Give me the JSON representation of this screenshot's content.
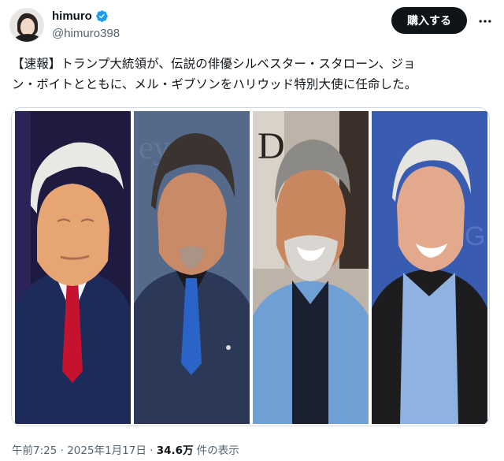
{
  "author": {
    "display_name": "himuro",
    "handle": "@himuro398",
    "verified": true
  },
  "header": {
    "buy_label": "購入する",
    "more_icon": "more-horizontal-icon"
  },
  "tweet": {
    "text_line1": "【速報】トランプ大統領が、伝説の俳優シルベスター・スタローン、ジョ",
    "text_line2": "ン・ボイトとともに、メル・ギブソンをハリウッド特別大使に任命した。"
  },
  "media": {
    "photo_count": 4
  },
  "footer": {
    "time": "午前7:25",
    "sep1": " · ",
    "date": "2025年1月17日",
    "sep2": " · ",
    "views_count": "34.6万",
    "views_label": " 件の表示"
  },
  "colors": {
    "text": "#0f1419",
    "secondary": "#536471",
    "verified": "#1d9bf0",
    "button_bg": "#0f1419"
  }
}
